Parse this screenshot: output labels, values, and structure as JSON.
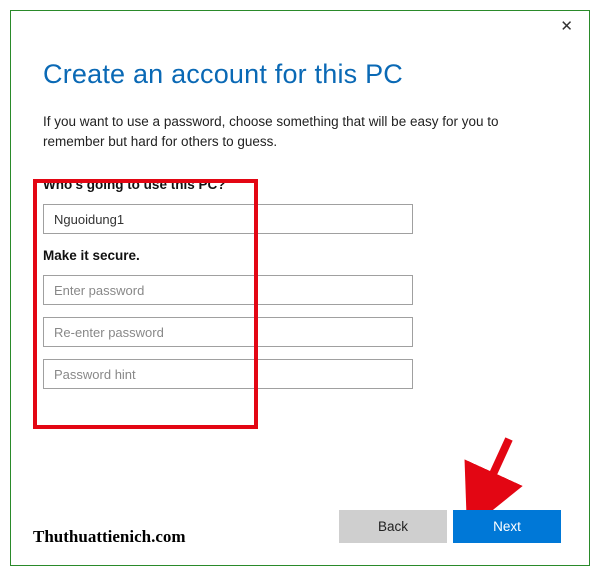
{
  "title": "Create an account for this PC",
  "description": "If you want to use a password, choose something that will be easy for you to remember but hard for others to guess.",
  "section1_label": "Who's going to use this PC?",
  "username_value": "Nguoidung1",
  "section2_label": "Make it secure.",
  "password_placeholder": "Enter password",
  "password2_placeholder": "Re-enter password",
  "hint_placeholder": "Password hint",
  "buttons": {
    "back": "Back",
    "next": "Next"
  },
  "watermark": "Thuthuattienich.com"
}
